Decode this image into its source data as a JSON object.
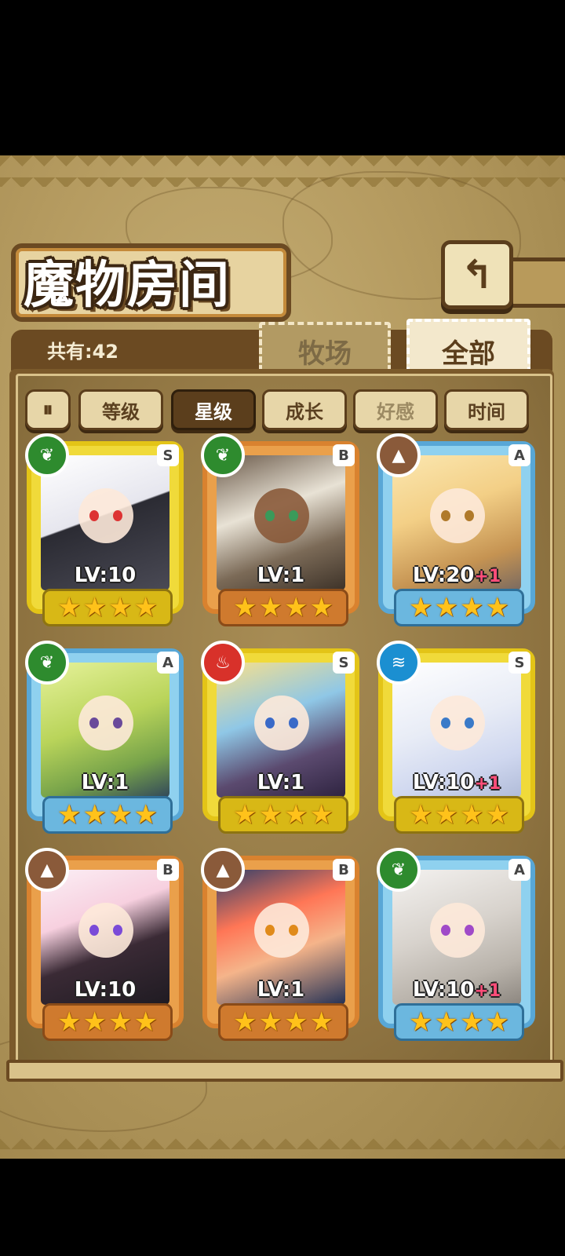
{
  "header": {
    "title": "魔物房间",
    "back_icon": "return-arrow-icon"
  },
  "summary": {
    "count_label": "共有:42"
  },
  "tabs": [
    {
      "label": "牧场",
      "active": false
    },
    {
      "label": "全部",
      "active": true
    }
  ],
  "sort": {
    "filter_toggle_icon": "filter-toggle-icon",
    "buttons": [
      {
        "label": "等级",
        "selected": false
      },
      {
        "label": "星级",
        "selected": true
      },
      {
        "label": "成长",
        "selected": false
      },
      {
        "label": "好感",
        "selected": false
      },
      {
        "label": "时间",
        "selected": false
      }
    ]
  },
  "monsters": [
    {
      "rank": "S",
      "level": "LV:10",
      "bonus": "",
      "element": "leaf",
      "frame": "gold",
      "stars": 4
    },
    {
      "rank": "B",
      "level": "LV:1",
      "bonus": "",
      "element": "leaf",
      "frame": "orange",
      "stars": 4
    },
    {
      "rank": "A",
      "level": "LV:20",
      "bonus": "+1",
      "element": "earth",
      "frame": "blue",
      "stars": 4
    },
    {
      "rank": "A",
      "level": "LV:1",
      "bonus": "",
      "element": "leaf",
      "frame": "blue",
      "stars": 4
    },
    {
      "rank": "S",
      "level": "LV:1",
      "bonus": "",
      "element": "fire",
      "frame": "gold",
      "stars": 4
    },
    {
      "rank": "S",
      "level": "LV:10",
      "bonus": "+1",
      "element": "water",
      "frame": "gold",
      "stars": 4
    },
    {
      "rank": "B",
      "level": "LV:10",
      "bonus": "",
      "element": "earth",
      "frame": "orange",
      "stars": 4
    },
    {
      "rank": "B",
      "level": "LV:1",
      "bonus": "",
      "element": "earth",
      "frame": "orange",
      "stars": 4
    },
    {
      "rank": "A",
      "level": "LV:10",
      "bonus": "+1",
      "element": "leaf",
      "frame": "blue",
      "stars": 4
    }
  ],
  "colors": {
    "gold_frame": "#e3c417",
    "orange_frame": "#d9822f",
    "blue_frame": "#58a7d6",
    "star": "#ffc21a",
    "bonus": "#ff4d79"
  }
}
